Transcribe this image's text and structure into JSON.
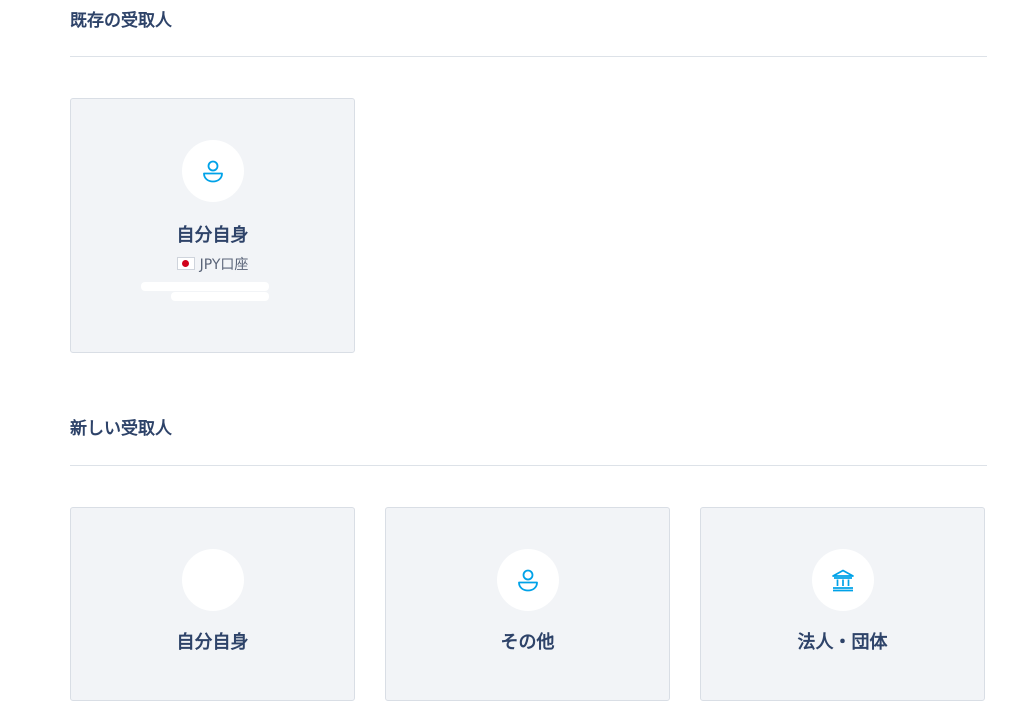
{
  "existing": {
    "title": "既存の受取人",
    "card": {
      "title": "自分自身",
      "sub": "JPY口座",
      "icon": "person-icon"
    }
  },
  "new": {
    "title": "新しい受取人",
    "cards": [
      {
        "title": "自分自身",
        "icon": ""
      },
      {
        "title": "その他",
        "icon": "person-icon"
      },
      {
        "title": "法人・団体",
        "icon": "bank-icon"
      }
    ]
  },
  "colors": {
    "accent": "#00a2e8",
    "heading": "#2e4369",
    "card_bg": "#f2f4f7"
  }
}
